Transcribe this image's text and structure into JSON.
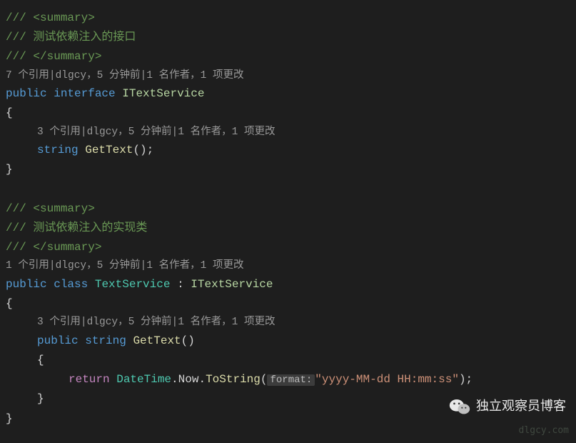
{
  "xmlSummaryOpen": "/// <summary>",
  "xmlSummaryClose": "/// </summary>",
  "interface": {
    "commentText": "/// 测试依赖注入的接口",
    "codelens": "7 个引用|dlgcy，5 分钟前|1 名作者，1 项更改",
    "signaturePublic": "public",
    "signatureInterface": "interface",
    "name": "ITextService",
    "methodCodelens": "3 个引用|dlgcy，5 分钟前|1 名作者，1 项更改",
    "methodReturnType": "string",
    "methodName": "GetText",
    "methodParens": "();"
  },
  "class": {
    "commentText": "/// 测试依赖注入的实现类",
    "codelens": "1 个引用|dlgcy，5 分钟前|1 名作者，1 项更改",
    "signaturePublic": "public",
    "signatureClass": "class",
    "name": "TextService",
    "colon": " : ",
    "implements": "ITextService",
    "methodCodelens": "3 个引用|dlgcy，5 分钟前|1 名作者，1 项更改",
    "methodPublic": "public",
    "methodReturnType": "string",
    "methodName": "GetText",
    "methodParens": "()",
    "returnKw": "return",
    "dateTimeType": "DateTime",
    "dot1": ".",
    "nowProp": "Now",
    "dot2": ".",
    "toStringMethod": "ToString",
    "hintLabel": "format:",
    "formatString": "\"yyyy-MM-dd HH:mm:ss\"",
    "callClose": ");"
  },
  "watermark": {
    "text": "独立观察员博客",
    "url": "dlgcy.com"
  }
}
